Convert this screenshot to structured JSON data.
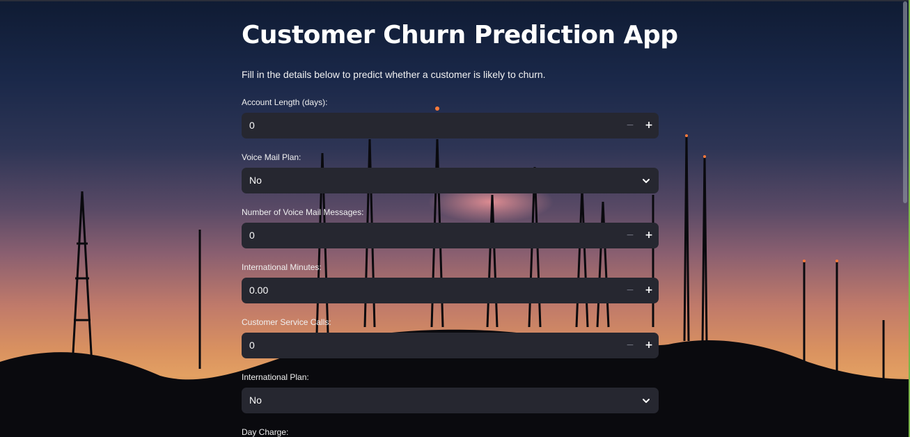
{
  "app": {
    "title": "Customer Churn Prediction App",
    "subtitle": "Fill in the details below to predict whether a customer is likely to churn."
  },
  "form": {
    "account_length": {
      "label": "Account Length (days):",
      "value": "0"
    },
    "voice_mail_plan": {
      "label": "Voice Mail Plan:",
      "value": "No"
    },
    "voice_mail_messages": {
      "label": "Number of Voice Mail Messages:",
      "value": "0"
    },
    "international_minutes": {
      "label": "International Minutes:",
      "value": "0.00"
    },
    "customer_service_calls": {
      "label": "Customer Service Calls:",
      "value": "0"
    },
    "international_plan": {
      "label": "International Plan:",
      "value": "No"
    },
    "day_charge": {
      "label": "Day Charge:"
    }
  },
  "stepper": {
    "minus": "−",
    "plus": "+"
  },
  "colors": {
    "input_bg": "#262730",
    "text": "#ffffff",
    "accent_strip": "#7ab648"
  },
  "icons": {
    "dropdown": "chevron-down-icon",
    "decrement": "minus-icon",
    "increment": "plus-icon"
  }
}
